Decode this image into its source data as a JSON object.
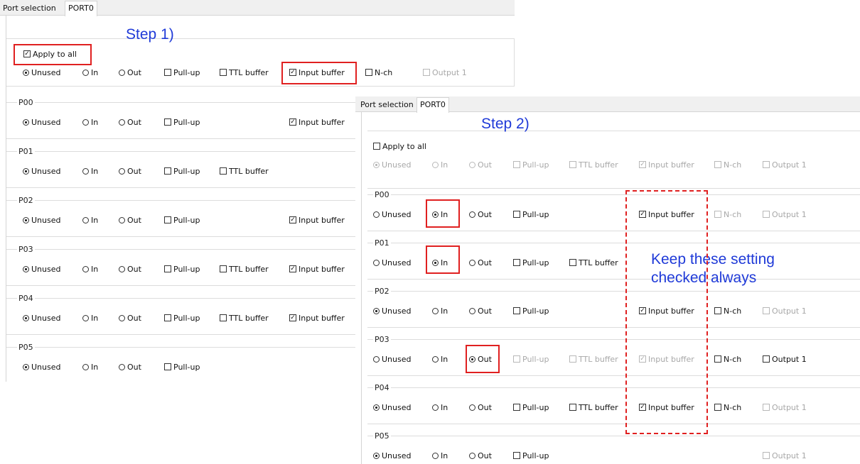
{
  "tabs": {
    "port_selection": "Port selection",
    "port0": "PORT0"
  },
  "labels": {
    "apply_to_all": "Apply to all",
    "unused": "Unused",
    "in": "In",
    "out": "Out",
    "pullup": "Pull-up",
    "ttl": "TTL buffer",
    "input_buffer": "Input buffer",
    "nch": "N-ch",
    "output1": "Output 1"
  },
  "annotations": {
    "step1": "Step 1)",
    "step2": "Step 2)",
    "keep_line1": "Keep these setting",
    "keep_line2": "checked always"
  },
  "panel1": {
    "apply_all": {
      "checked": true,
      "mode": "Unused",
      "pullup": false,
      "ttl": false,
      "input_buffer": true,
      "nch": false,
      "output1": false
    },
    "ports": [
      {
        "name": "P00",
        "mode": "Unused",
        "pullup": false,
        "ttl": null,
        "input_buffer": true
      },
      {
        "name": "P01",
        "mode": "Unused",
        "pullup": false,
        "ttl": false,
        "input_buffer": null
      },
      {
        "name": "P02",
        "mode": "Unused",
        "pullup": false,
        "ttl": null,
        "input_buffer": true
      },
      {
        "name": "P03",
        "mode": "Unused",
        "pullup": false,
        "ttl": false,
        "input_buffer": true
      },
      {
        "name": "P04",
        "mode": "Unused",
        "pullup": false,
        "ttl": false,
        "input_buffer": true
      },
      {
        "name": "P05",
        "mode": "Unused",
        "pullup": false,
        "ttl": null,
        "input_buffer": null
      }
    ]
  },
  "panel2": {
    "apply_all": {
      "checked": false,
      "mode": "Unused",
      "pullup": false,
      "ttl": false,
      "input_buffer": true,
      "nch": false,
      "output1": false
    },
    "ports": [
      {
        "name": "P00",
        "mode": "In",
        "pullup": false,
        "ttl": null,
        "input_buffer": true,
        "nch": false,
        "output1": false
      },
      {
        "name": "P01",
        "mode": "In",
        "pullup": false,
        "ttl": false,
        "input_buffer": null,
        "nch": null,
        "output1": null
      },
      {
        "name": "P02",
        "mode": "Unused",
        "pullup": false,
        "ttl": null,
        "input_buffer": true,
        "nch": false,
        "output1": false
      },
      {
        "name": "P03",
        "mode": "Out",
        "pullup": false,
        "ttl": false,
        "input_buffer": true,
        "nch": false,
        "output1": false
      },
      {
        "name": "P04",
        "mode": "Unused",
        "pullup": false,
        "ttl": false,
        "input_buffer": true,
        "nch": false,
        "output1": false
      },
      {
        "name": "P05",
        "mode": "Unused",
        "pullup": false,
        "ttl": null,
        "input_buffer": null,
        "nch": null,
        "output1": false
      }
    ]
  }
}
